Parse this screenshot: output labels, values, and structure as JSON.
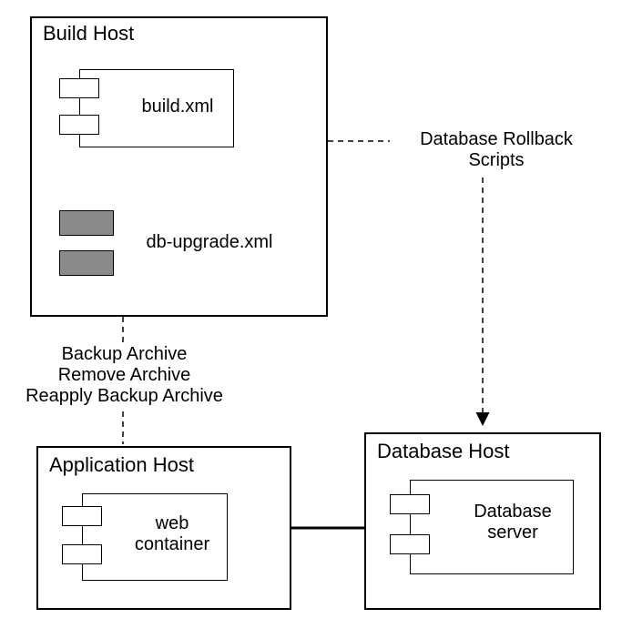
{
  "build_host": {
    "title": "Build Host",
    "component1_label": "build.xml",
    "component2_label": "db-upgrade.xml"
  },
  "app_host": {
    "title": "Application Host",
    "component_label": "web\ncontainer"
  },
  "db_host": {
    "title": "Database Host",
    "component_label": "Database\nserver"
  },
  "edge_build_to_db": "Database Rollback\nScripts",
  "edge_build_to_app": "Backup Archive\nRemove Archive\nReapply Backup Archive"
}
